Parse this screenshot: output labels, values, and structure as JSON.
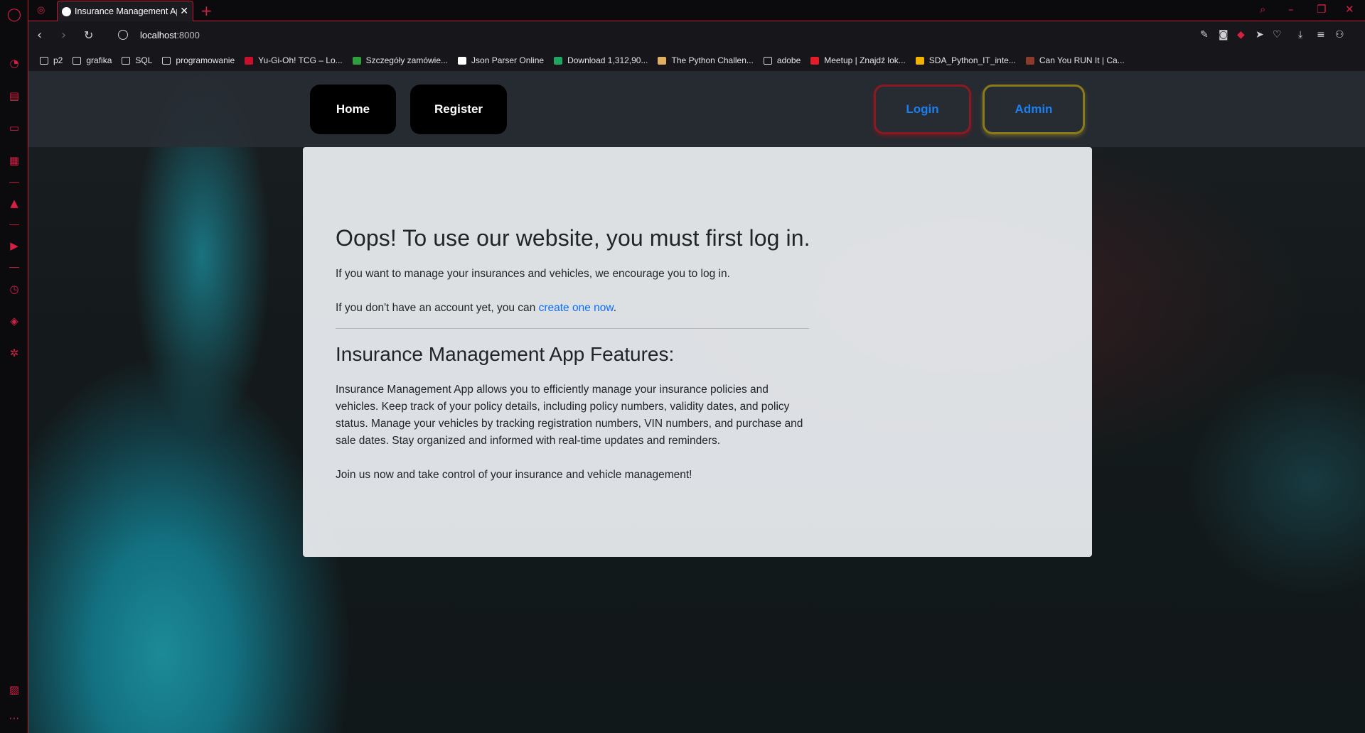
{
  "browser": {
    "tab_title": "Insurance Management App",
    "url_host": "localhost",
    "url_port": ":8000",
    "accent_color": "#d61f45",
    "bookmarks": [
      {
        "label": "p2",
        "icon": "folder-icon"
      },
      {
        "label": "grafika",
        "icon": "folder-icon"
      },
      {
        "label": "SQL",
        "icon": "folder-icon"
      },
      {
        "label": "programowanie",
        "icon": "folder-icon"
      },
      {
        "label": "Yu-Gi-Oh! TCG – Lo...",
        "icon": "site-icon"
      },
      {
        "label": "Szczegóły zamówie...",
        "icon": "site-icon"
      },
      {
        "label": "Json Parser Online",
        "icon": "site-icon"
      },
      {
        "label": "Download 1,312,90...",
        "icon": "site-icon"
      },
      {
        "label": "The Python Challen...",
        "icon": "site-icon"
      },
      {
        "label": "adobe",
        "icon": "folder-icon"
      },
      {
        "label": "Meetup | Znajdź lok...",
        "icon": "site-icon"
      },
      {
        "label": "SDA_Python_IT_inte...",
        "icon": "site-icon"
      },
      {
        "label": "Can You RUN It | Ca...",
        "icon": "site-icon"
      }
    ]
  },
  "nav": {
    "home": "Home",
    "register": "Register",
    "login": "Login",
    "admin": "Admin",
    "link_color": "#1a7ff0"
  },
  "main": {
    "heading": "Oops! To use our website, you must first log in.",
    "intro": "If you want to manage your insurances and vehicles, we encourage you to log in.",
    "no_account_prefix": "If you don't have an account yet, you can ",
    "create_link": "create one now",
    "no_account_suffix": ".",
    "features_heading": "Insurance Management App Features:",
    "features_text": "Insurance Management App allows you to efficiently manage your insurance policies and vehicles. Keep track of your policy details, including policy numbers, validity dates, and policy status. Manage your vehicles by tracking registration numbers, VIN numbers, and purchase and sale dates. Stay organized and informed with real-time updates and reminders.",
    "join_text": "Join us now and take control of your insurance and vehicle management!"
  }
}
